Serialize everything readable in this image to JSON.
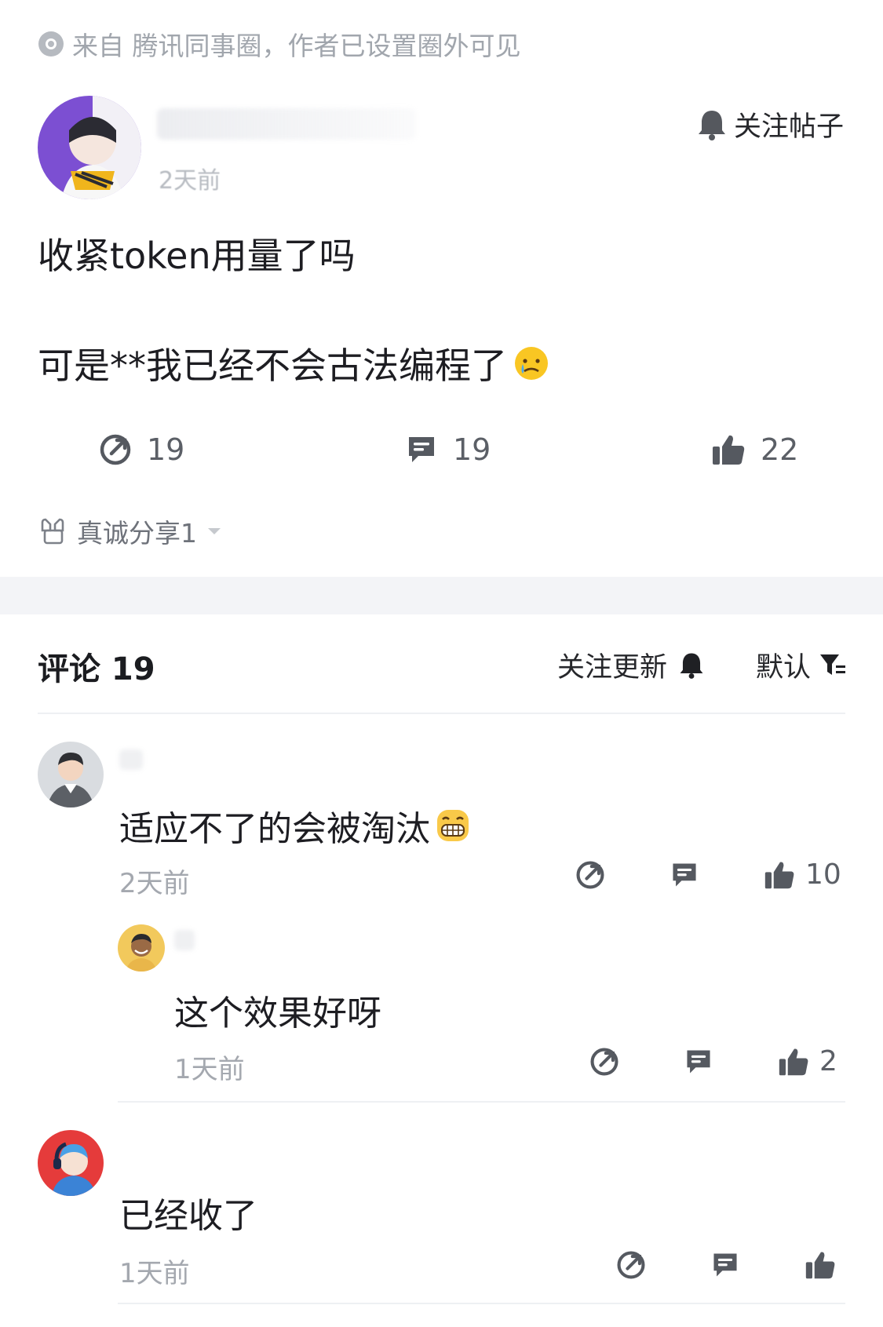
{
  "source": {
    "text": "来自 腾讯同事圈，作者已设置圈外可见"
  },
  "post": {
    "author_time": "2天前",
    "follow_label": "关注帖子",
    "line1": "收紧token用量了吗",
    "line2": "可是**我已经不会古法编程了",
    "line2_emoji": "crying-face-icon",
    "stats": {
      "shares": "19",
      "comments": "19",
      "likes": "22"
    },
    "tag": "真诚分享1"
  },
  "comments_header": {
    "title": "评论 19",
    "follow_updates": "关注更新",
    "sort": "默认"
  },
  "comments": [
    {
      "text": "适应不了的会被淘汰",
      "emoji": "grin-icon",
      "time": "2天前",
      "likes": "10"
    },
    {
      "text": "这个效果好呀",
      "time": "1天前",
      "likes": "2",
      "reply": true
    },
    {
      "text": "已经收了",
      "time": "1天前",
      "likes": ""
    }
  ],
  "colors": {
    "accent": "#1f1f24",
    "muted": "#9aa0a8",
    "divider": "#f3f4f7"
  }
}
